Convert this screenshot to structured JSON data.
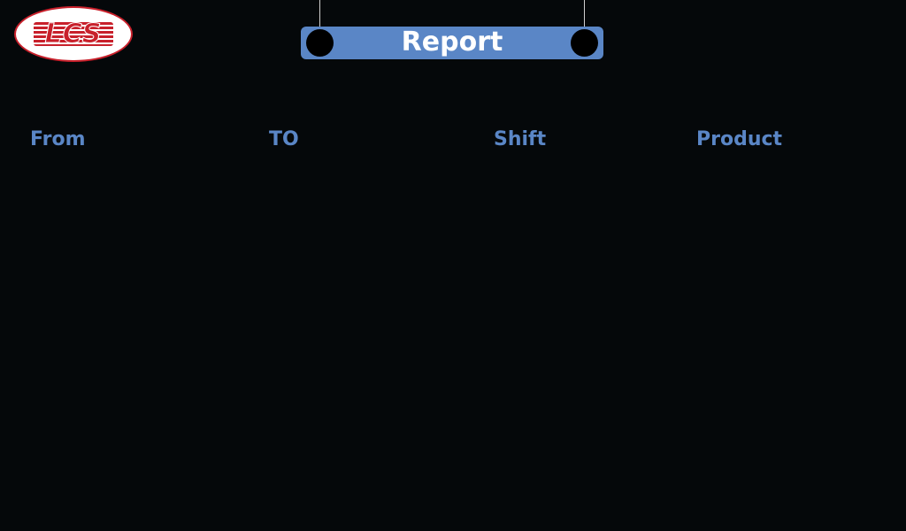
{
  "logo": {
    "text": "LCS",
    "brand_color": "#c8202b"
  },
  "header": {
    "title": "Report",
    "banner_color": "#5a86c6"
  },
  "table": {
    "columns": [
      "From",
      "TO",
      "Shift",
      "Product"
    ],
    "header_color": "#5a86c6",
    "rows": []
  },
  "theme": {
    "background": "#05080a"
  }
}
